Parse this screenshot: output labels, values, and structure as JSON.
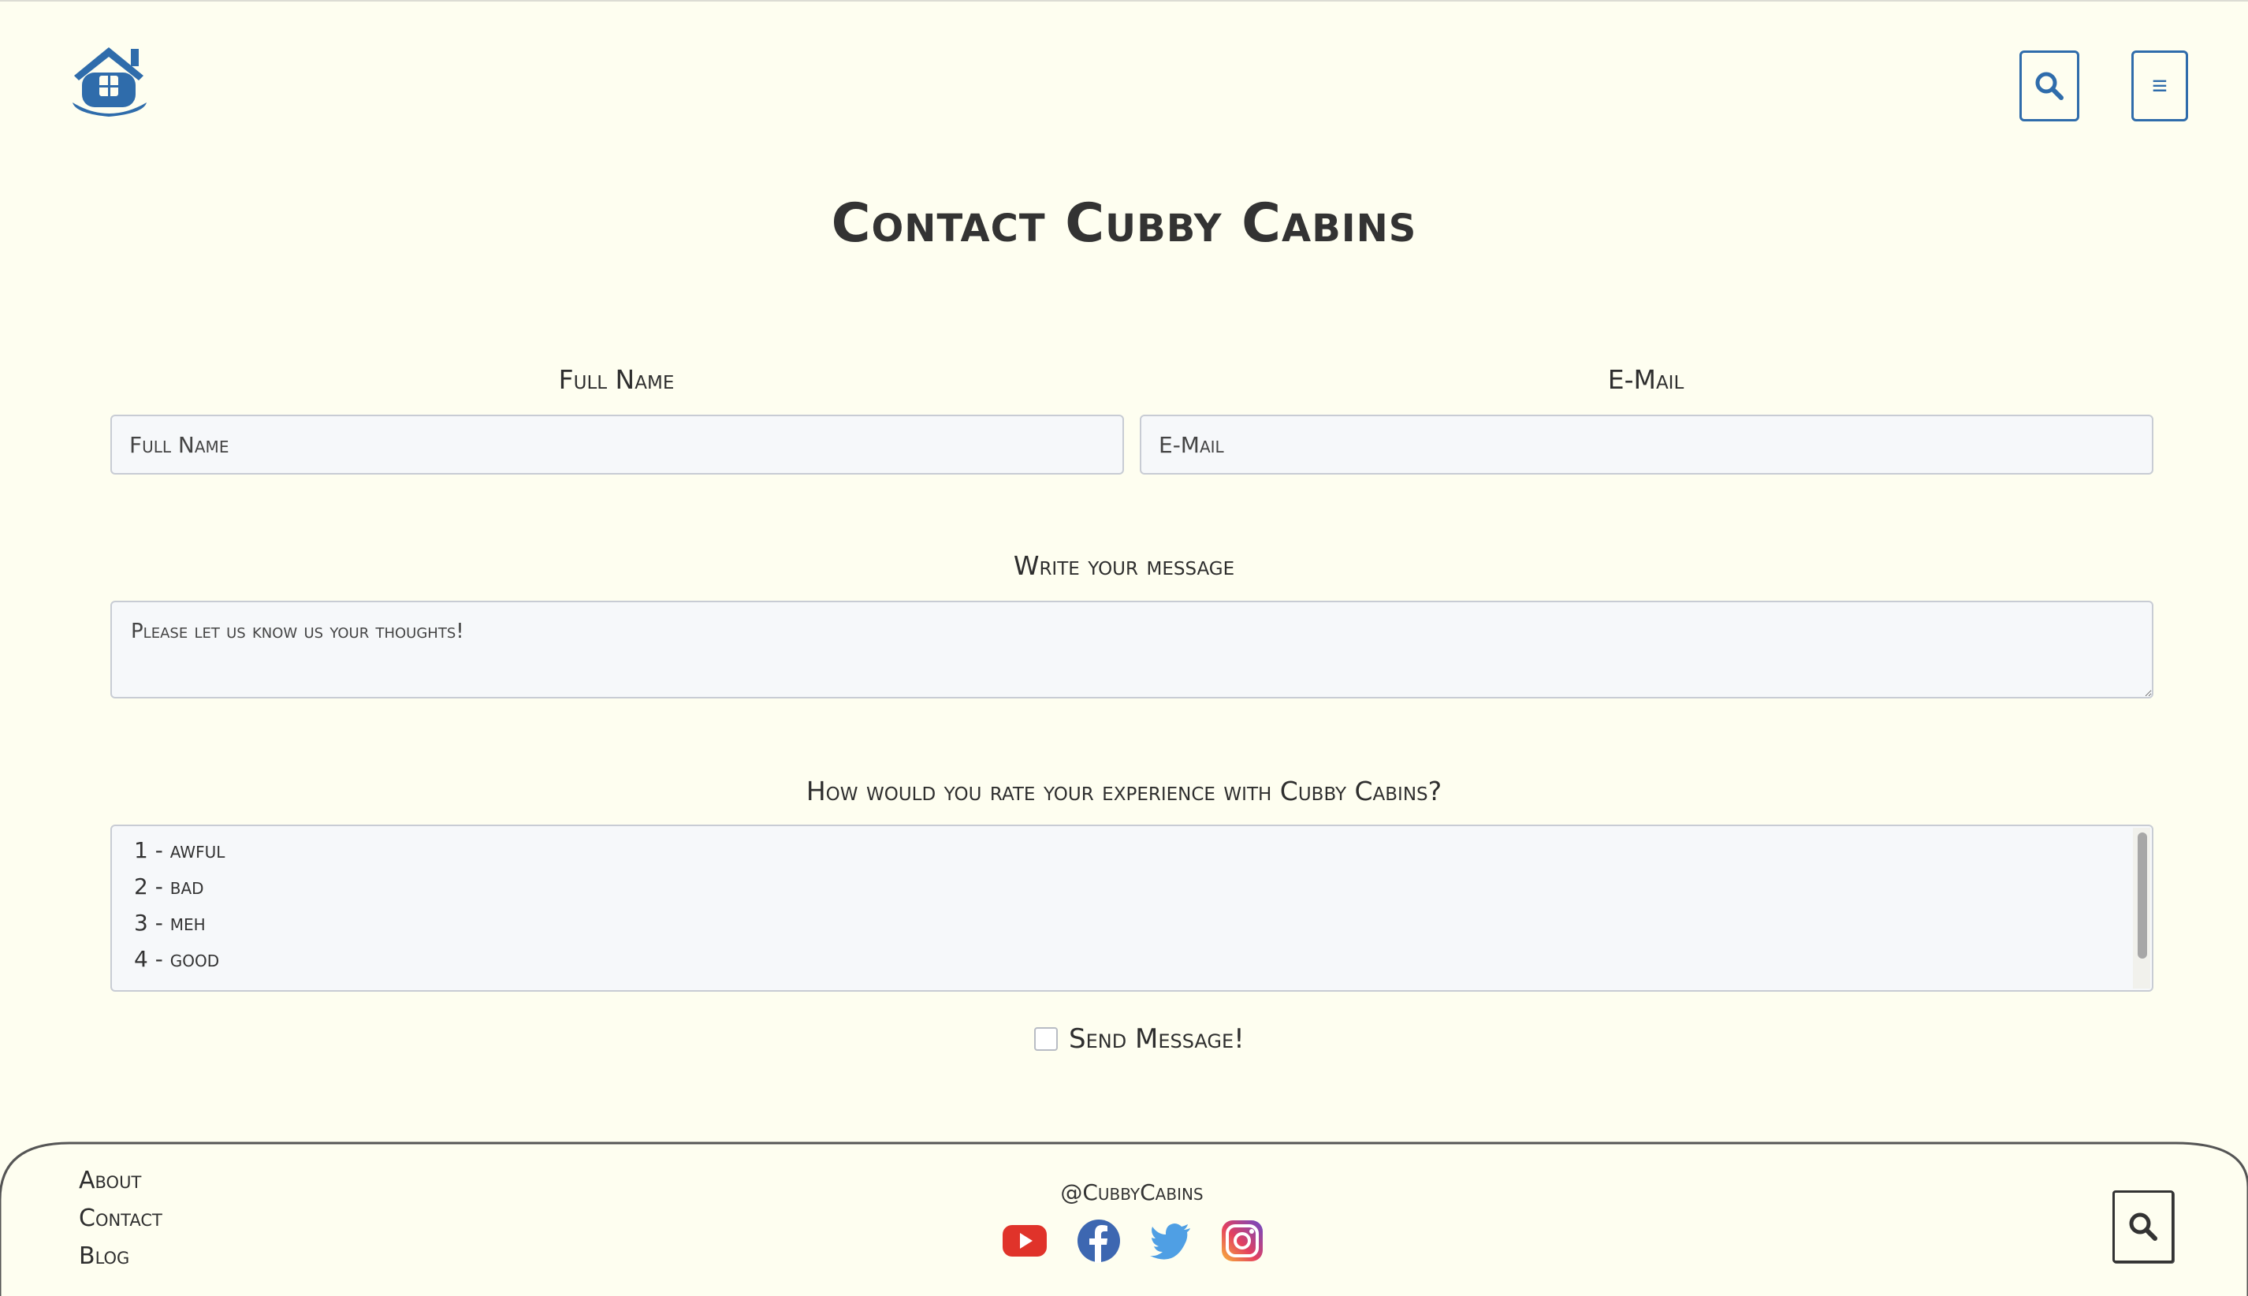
{
  "header": {
    "logo_icon": "house-icon",
    "search_icon": "search-icon",
    "menu_glyph": "≡"
  },
  "page_title": "Contact Cubby Cabins",
  "form": {
    "full_name_label": "Full Name",
    "full_name_placeholder": "Full Name",
    "email_label": "E-Mail",
    "email_placeholder": "E-Mail",
    "message_label": "Write your message",
    "message_placeholder": "Please let us know us your thoughts!",
    "rating_label": "How would you rate your experience with Cubby Cabins?",
    "rating_options": [
      "1 - awful",
      "2 - bad",
      "3 - meh",
      "4 - good"
    ],
    "send_label": "Send Message!"
  },
  "footer": {
    "links": [
      "About",
      "Contact",
      "Blog"
    ],
    "handle": "@CubbyCabins",
    "social_icons": [
      "youtube-icon",
      "facebook-icon",
      "twitter-icon",
      "instagram-icon"
    ]
  },
  "colors": {
    "background": "#fefef0",
    "accent": "#2f6cab",
    "input_bg": "#f6f8fa",
    "youtube": "#e0332a",
    "facebook": "#3d67b1",
    "twitter": "#4f9fe4"
  }
}
